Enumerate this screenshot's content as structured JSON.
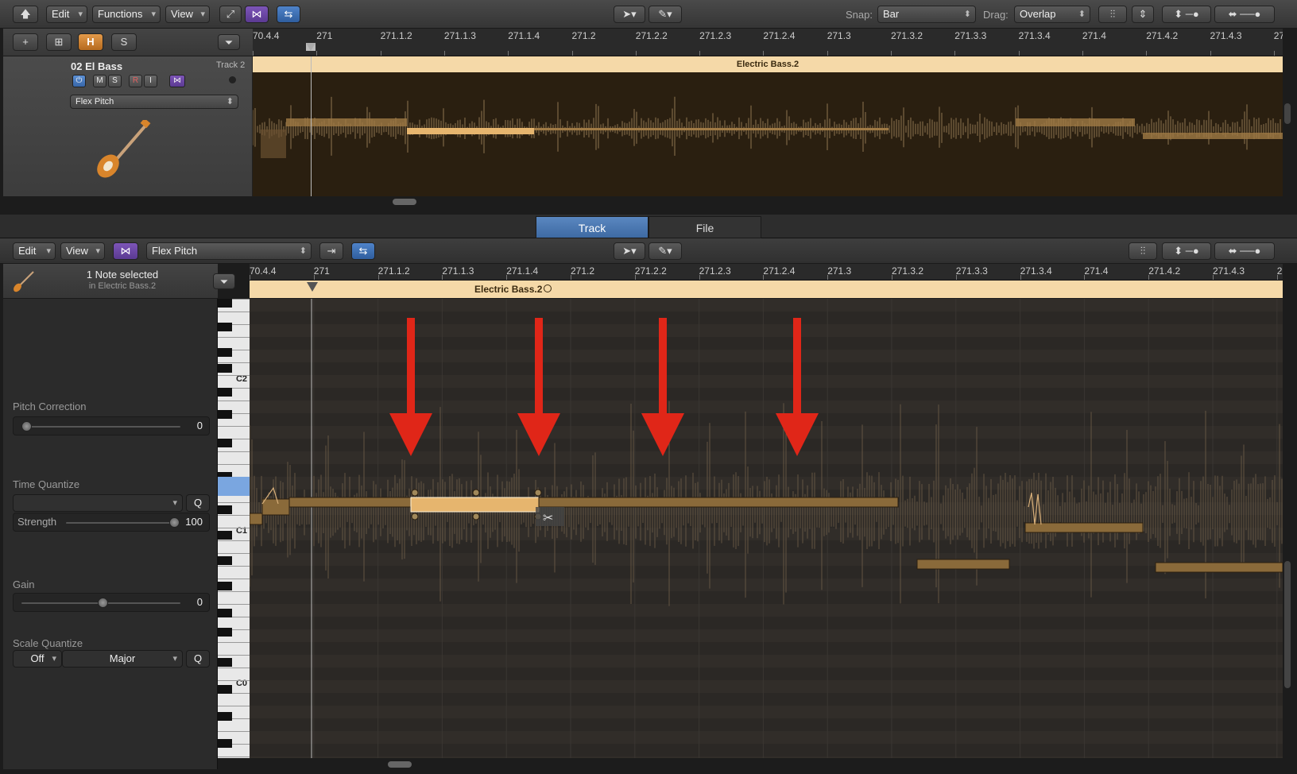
{
  "top_toolbar": {
    "edit": "Edit",
    "functions": "Functions",
    "view": "View",
    "snap_label": "Snap:",
    "snap_value": "Bar",
    "drag_label": "Drag:",
    "drag_value": "Overlap"
  },
  "track_toolbar": {
    "h_label": "H",
    "s_label": "S"
  },
  "ruler_top": [
    "70.4.4",
    "271",
    "271.1.2",
    "271.1.3",
    "271.1.4",
    "271.2",
    "271.2.2",
    "271.2.3",
    "271.2.4",
    "271.3",
    "271.3.2",
    "271.3.3",
    "271.3.4",
    "271.4",
    "271.4.2",
    "271.4.3",
    "27"
  ],
  "track": {
    "name": "02 El Bass",
    "number": "Track 2",
    "buttons": [
      "M",
      "S",
      "R",
      "I"
    ],
    "flex_mode": "Flex Pitch",
    "region_name": "Electric Bass.2"
  },
  "tabs": {
    "track": "Track",
    "file": "File"
  },
  "editor_toolbar": {
    "edit": "Edit",
    "view": "View",
    "flex_mode": "Flex Pitch"
  },
  "ruler_bottom": [
    "70.4.4",
    "271",
    "271.1.2",
    "271.1.3",
    "271.1.4",
    "271.2",
    "271.2.2",
    "271.2.3",
    "271.2.4",
    "271.3",
    "271.3.2",
    "271.3.3",
    "271.3.4",
    "271.4",
    "271.4.2",
    "271.4.3",
    "2"
  ],
  "inspector": {
    "selection": "1 Note selected",
    "selection_sub": "in Electric Bass.2",
    "pitch_correction_label": "Pitch Correction",
    "pitch_correction_value": "0",
    "time_quantize_label": "Time Quantize",
    "time_quantize_value": "",
    "q_label": "Q",
    "strength_label": "Strength",
    "strength_value": "100",
    "gain_label": "Gain",
    "gain_value": "0",
    "scale_quantize_label": "Scale Quantize",
    "scale_off": "Off",
    "scale_major": "Major"
  },
  "keyboard_labels": [
    "C2",
    "C1",
    "C0"
  ],
  "editor_region": "Electric Bass.2",
  "colors": {
    "region_header": "#f5d9a8",
    "note_fill": "#8a6a3a",
    "note_selected": "#e6b56e",
    "arrow": "#e02618",
    "tab_active": "#4a78b3"
  }
}
